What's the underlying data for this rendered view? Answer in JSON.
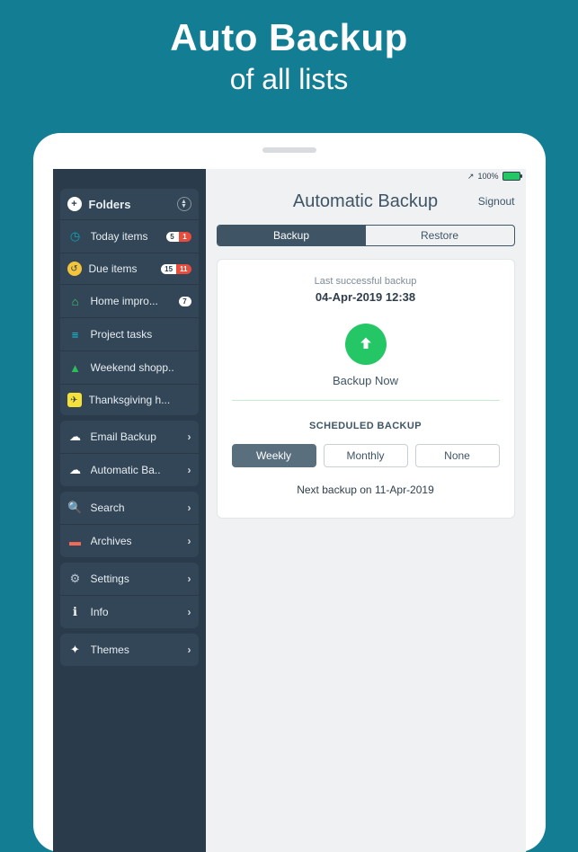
{
  "promo": {
    "line1": "Auto Backup",
    "line2": "of all lists"
  },
  "status": {
    "signal": "100%",
    "arrow": "↗"
  },
  "sidebar": {
    "folders_header": "Folders",
    "folders": [
      {
        "icon": "clock-icon",
        "label": "Today items",
        "badge_white": "5",
        "badge_red": "1"
      },
      {
        "icon": "history-icon",
        "label": "Due items",
        "badge_white": "15",
        "badge_red": "11"
      },
      {
        "icon": "home-icon",
        "label": "Home impro...",
        "badge_white": "7",
        "badge_red": ""
      },
      {
        "icon": "list-icon",
        "label": "Project tasks",
        "badge_white": "",
        "badge_red": ""
      },
      {
        "icon": "bag-icon",
        "label": "Weekend shopp..",
        "badge_white": "",
        "badge_red": ""
      },
      {
        "icon": "plane-icon",
        "label": "Thanksgiving h...",
        "badge_white": "",
        "badge_red": ""
      }
    ],
    "backup_group": [
      {
        "icon": "cloud-icon",
        "label": "Email Backup"
      },
      {
        "icon": "cloud-icon",
        "label": "Automatic Ba.."
      }
    ],
    "tools_group": [
      {
        "icon": "search-icon",
        "label": "Search"
      },
      {
        "icon": "archive-icon",
        "label": "Archives"
      }
    ],
    "settings_group": [
      {
        "icon": "gear-icon",
        "label": "Settings"
      },
      {
        "icon": "info-icon",
        "label": "Info"
      }
    ],
    "themes_group": [
      {
        "icon": "theme-icon",
        "label": "Themes"
      }
    ]
  },
  "main": {
    "title": "Automatic Backup",
    "signout": "Signout",
    "tabs": {
      "backup": "Backup",
      "restore": "Restore",
      "active": "backup"
    },
    "last_backup_label": "Last successful backup",
    "last_backup_value": "04-Apr-2019 12:38",
    "backup_now": "Backup Now",
    "scheduled_title": "SCHEDULED BACKUP",
    "schedule_options": {
      "weekly": "Weekly",
      "monthly": "Monthly",
      "none": "None",
      "active": "weekly"
    },
    "next_backup": "Next backup on 11-Apr-2019"
  }
}
